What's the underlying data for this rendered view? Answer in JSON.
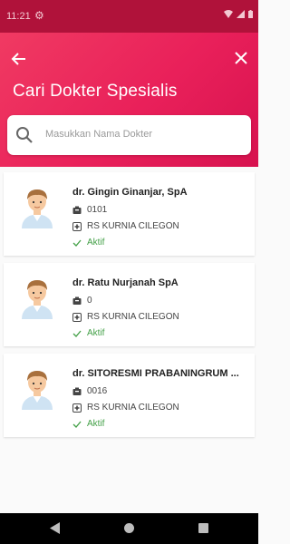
{
  "statusbar": {
    "time": "11:21"
  },
  "header": {
    "title": "Cari Dokter Spesialis"
  },
  "search": {
    "placeholder": "Masukkan Nama Dokter"
  },
  "doctors": [
    {
      "name": "dr. Gingin Ginanjar, SpA",
      "code": "0101",
      "hospital": "RS KURNIA CILEGON",
      "status": "Aktif"
    },
    {
      "name": "dr. Ratu Nurjanah SpA",
      "code": "0",
      "hospital": "RS KURNIA CILEGON",
      "status": "Aktif"
    },
    {
      "name": "dr. SITORESMI PRABANINGRUM ...",
      "code": "0016",
      "hospital": "RS KURNIA CILEGON",
      "status": "Aktif"
    }
  ],
  "colors": {
    "accent": "#e9205a",
    "status_active": "#43a047"
  },
  "icons": [
    "settings-icon",
    "wifi-icon",
    "signal-icon",
    "battery-icon",
    "back-arrow-icon",
    "close-icon",
    "search-icon",
    "doctor-avatar-icon",
    "badge-icon",
    "hospital-icon",
    "check-icon"
  ]
}
